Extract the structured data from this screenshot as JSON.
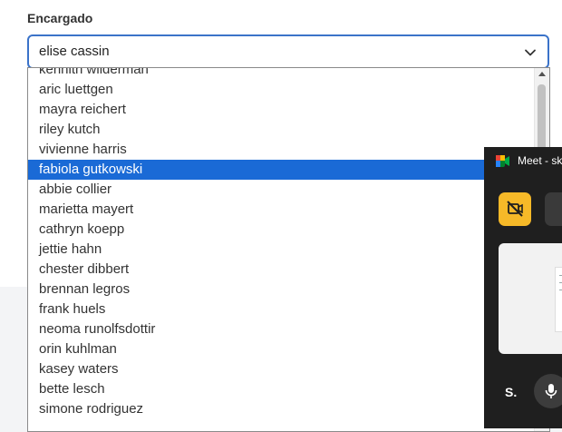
{
  "form": {
    "field_label": "Encargado",
    "select_value": "elise cassin"
  },
  "dropdown": {
    "options": [
      "kennith wilderman",
      "aric luettgen",
      "mayra reichert",
      "riley kutch",
      "vivienne harris",
      "fabiola gutkowski",
      "abbie collier",
      "marietta mayert",
      "cathryn koepp",
      "jettie hahn",
      "chester dibbert",
      "brennan legros",
      "frank huels",
      "neoma runolfsdottir",
      "orin kuhlman",
      "kasey waters",
      "bette lesch",
      "simone rodriguez"
    ],
    "highlighted": "fabiola gutkowski"
  },
  "meet_window": {
    "title": "Meet - sk",
    "participant_initial": "S.",
    "camera_button_color": "#f6b928"
  },
  "colors": {
    "accent": "#1a6ad6",
    "select_border": "#3b73c9"
  },
  "icons": {
    "select_chevron": "chevron-down-icon",
    "meet_logo": "google-meet-icon",
    "camera_off": "camera-off-icon",
    "microphone": "microphone-icon"
  }
}
